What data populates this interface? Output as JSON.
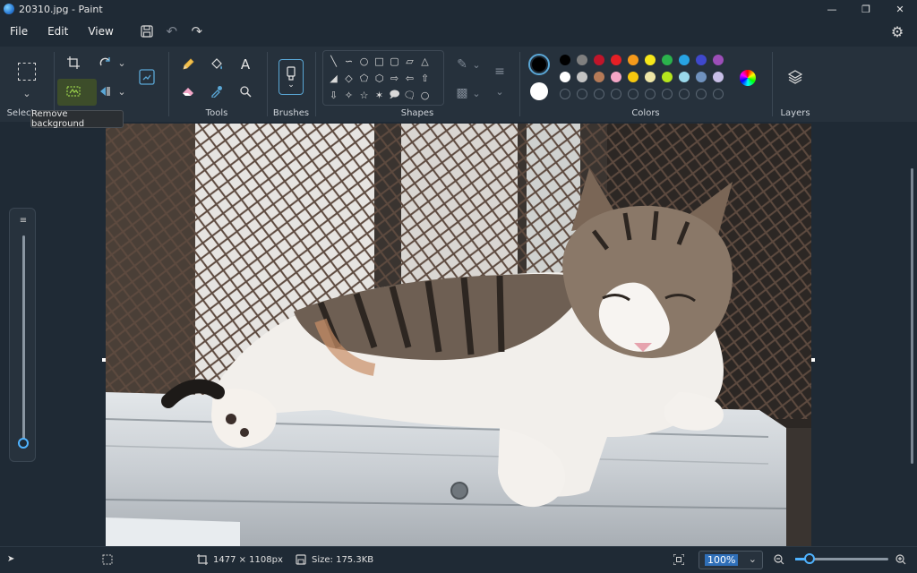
{
  "window": {
    "title": "20310.jpg - Paint"
  },
  "menu": {
    "file": "File",
    "edit": "Edit",
    "view": "View"
  },
  "ribbon": {
    "select_label": "Select",
    "tools_label": "Tools",
    "brushes_label": "Brushes",
    "shapes_label": "Shapes",
    "colors_label": "Colors",
    "layers_label": "Layers"
  },
  "tooltip": {
    "text": "Remove background"
  },
  "colors": {
    "primary": "#000000",
    "secondary": "#ffffff",
    "row1": [
      "#000000",
      "#7f7f7f",
      "#c0152a",
      "#e51f25",
      "#f59a1b",
      "#f6e71a",
      "#2bb24c",
      "#27a3e3",
      "#3f48cc",
      "#9c4eb8"
    ],
    "row2": [
      "#ffffff",
      "#c3c3c3",
      "#b57a57",
      "#f4a6c6",
      "#f7c80f",
      "#eee6a6",
      "#b6e61d",
      "#9ad8ea",
      "#7092be",
      "#c8bfe7"
    ]
  },
  "status": {
    "dimensions": "1477 × 1108px",
    "size": "Size: 175.3KB",
    "zoom": "100%"
  },
  "icons": [
    "pointer-icon",
    "selection-icon",
    "crop-icon",
    "rotate-icon",
    "remove-background-icon",
    "pencil-icon",
    "fill-icon",
    "text-icon",
    "eraser-icon",
    "color-picker-icon",
    "magnifier-icon",
    "brush-icon",
    "layers-icon",
    "settings-icon",
    "save-icon",
    "undo-icon",
    "redo-icon",
    "zoom-in-icon",
    "zoom-out-icon",
    "fit-icon"
  ]
}
